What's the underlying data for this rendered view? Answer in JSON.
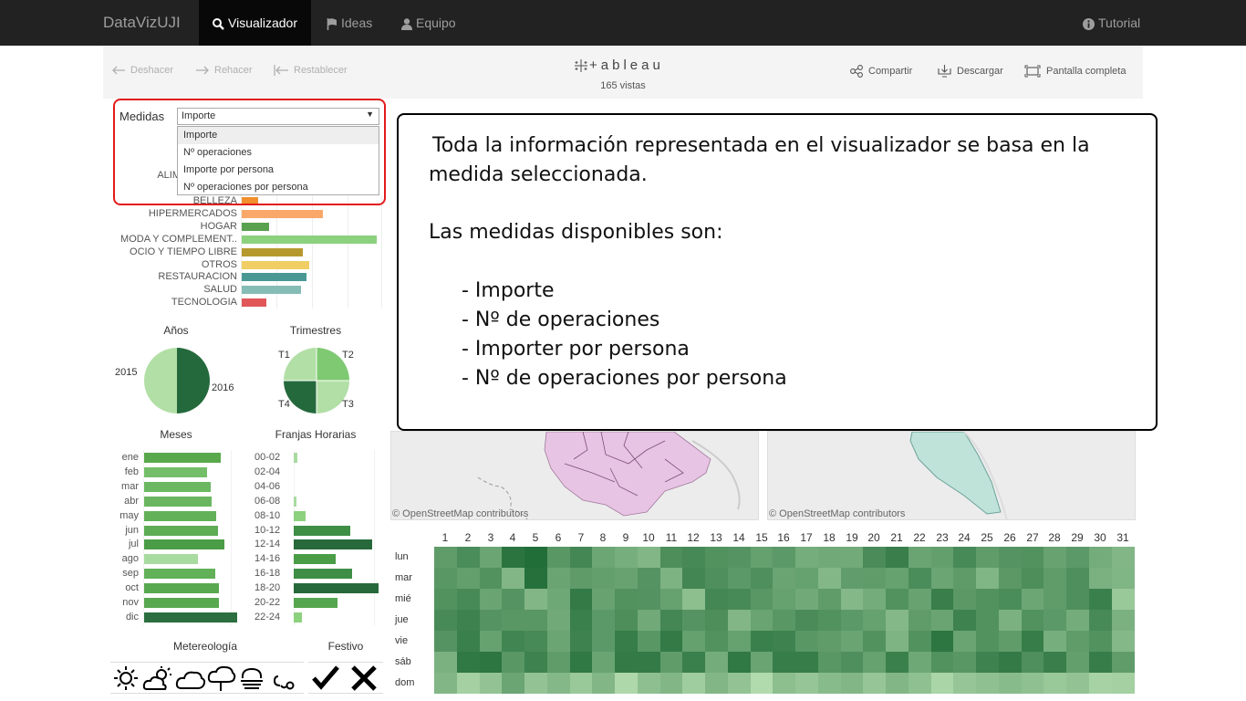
{
  "navbar": {
    "brand": "DataVizUJI",
    "items": [
      {
        "label": "Visualizador",
        "icon": "search-icon",
        "active": true
      },
      {
        "label": "Ideas",
        "icon": "flag-icon",
        "active": false
      },
      {
        "label": "Equipo",
        "icon": "user-icon",
        "active": false
      }
    ],
    "tutorial": {
      "label": "Tutorial",
      "icon": "info-icon"
    }
  },
  "toolbar": {
    "undo": "Deshacer",
    "redo": "Rehacer",
    "reset": "Restablecer",
    "logo": "+ableau",
    "views": "165 vistas",
    "share": "Compartir",
    "download": "Descargar",
    "fullscreen": "Pantalla completa"
  },
  "medidas": {
    "label": "Medidas",
    "selected": "Importe",
    "options": [
      "Importe",
      "Nº operaciones",
      "Importe por persona",
      "Nº operaciones por persona"
    ]
  },
  "categories": {
    "partial_label": "ALIM",
    "items": [
      {
        "label": "BELLEZA",
        "value": 0.12,
        "color": "#f28e2b"
      },
      {
        "label": "HIPERMERCADOS",
        "value": 0.6,
        "color": "#f9a86a"
      },
      {
        "label": "HOGAR",
        "value": 0.2,
        "color": "#59a14f"
      },
      {
        "label": "MODA Y COMPLEMENT..",
        "value": 1.0,
        "color": "#8cd17d"
      },
      {
        "label": "OCIO Y TIEMPO LIBRE",
        "value": 0.45,
        "color": "#b6992d"
      },
      {
        "label": "OTROS",
        "value": 0.5,
        "color": "#f1ce63"
      },
      {
        "label": "RESTAURACION",
        "value": 0.48,
        "color": "#499894"
      },
      {
        "label": "SALUD",
        "value": 0.44,
        "color": "#86bcb6"
      },
      {
        "label": "TECNOLOGIA",
        "value": 0.18,
        "color": "#e15759"
      }
    ]
  },
  "years": {
    "title": "Años",
    "labels": [
      "2015",
      "2016"
    ]
  },
  "quarters": {
    "title": "Trimestres",
    "labels": [
      "T1",
      "T2",
      "T3",
      "T4"
    ]
  },
  "months": {
    "title": "Meses",
    "items": [
      {
        "label": "ene",
        "value": 0.82,
        "color": "#59a84b"
      },
      {
        "label": "feb",
        "value": 0.68,
        "color": "#74be6a"
      },
      {
        "label": "mar",
        "value": 0.72,
        "color": "#6cb762"
      },
      {
        "label": "abr",
        "value": 0.73,
        "color": "#6ab660"
      },
      {
        "label": "may",
        "value": 0.77,
        "color": "#62b159"
      },
      {
        "label": "jun",
        "value": 0.79,
        "color": "#5ead54"
      },
      {
        "label": "jul",
        "value": 0.86,
        "color": "#4a9d46"
      },
      {
        "label": "ago",
        "value": 0.58,
        "color": "#a8dba0"
      },
      {
        "label": "sep",
        "value": 0.76,
        "color": "#62b159"
      },
      {
        "label": "oct",
        "value": 0.8,
        "color": "#58a850"
      },
      {
        "label": "nov",
        "value": 0.8,
        "color": "#58a850"
      },
      {
        "label": "dic",
        "value": 1.0,
        "color": "#2c6e3f"
      }
    ]
  },
  "hours": {
    "title": "Franjas Horarias",
    "items": [
      {
        "label": "00-02",
        "value": 0.04,
        "color": "#a8dba0"
      },
      {
        "label": "02-04",
        "value": 0.0,
        "color": "#a8dba0"
      },
      {
        "label": "04-06",
        "value": 0.0,
        "color": "#a8dba0"
      },
      {
        "label": "06-08",
        "value": 0.03,
        "color": "#a8dba0"
      },
      {
        "label": "08-10",
        "value": 0.14,
        "color": "#8cd17d"
      },
      {
        "label": "10-12",
        "value": 0.67,
        "color": "#3e8e45"
      },
      {
        "label": "12-14",
        "value": 0.93,
        "color": "#27693a"
      },
      {
        "label": "14-16",
        "value": 0.49,
        "color": "#4a9d46"
      },
      {
        "label": "16-18",
        "value": 0.69,
        "color": "#3e8e45"
      },
      {
        "label": "18-20",
        "value": 1.0,
        "color": "#27693a"
      },
      {
        "label": "20-22",
        "value": 0.52,
        "color": "#55a64e"
      },
      {
        "label": "22-24",
        "value": 0.1,
        "color": "#8cd17d"
      }
    ]
  },
  "weather": {
    "title": "Metereología",
    "icons": [
      "sun-icon",
      "sun-cloud-icon",
      "cloud-icon",
      "rain-cloud-icon",
      "fog-icon",
      "wind-icon"
    ]
  },
  "holiday": {
    "title": "Festivo",
    "icons": [
      "check-icon",
      "cross-icon"
    ]
  },
  "maps": {
    "attribution": "© OpenStreetMap contributors"
  },
  "heatmap": {
    "days": [
      "1",
      "2",
      "3",
      "4",
      "5",
      "6",
      "7",
      "8",
      "9",
      "10",
      "11",
      "12",
      "13",
      "14",
      "15",
      "16",
      "17",
      "18",
      "19",
      "20",
      "21",
      "22",
      "23",
      "24",
      "25",
      "26",
      "27",
      "28",
      "29",
      "30",
      "31"
    ],
    "weekdays": [
      "lun",
      "mar",
      "mié",
      "jue",
      "vie",
      "sáb",
      "dom"
    ],
    "values": [
      [
        0.62,
        0.74,
        0.55,
        0.93,
        0.98,
        0.66,
        0.78,
        0.54,
        0.48,
        0.42,
        0.73,
        0.77,
        0.7,
        0.68,
        0.59,
        0.64,
        0.49,
        0.52,
        0.51,
        0.75,
        0.85,
        0.56,
        0.6,
        0.76,
        0.62,
        0.68,
        0.7,
        0.57,
        0.64,
        0.5,
        0.42
      ],
      [
        0.66,
        0.6,
        0.7,
        0.42,
        0.96,
        0.56,
        0.63,
        0.6,
        0.57,
        0.68,
        0.45,
        0.79,
        0.72,
        0.64,
        0.72,
        0.56,
        0.58,
        0.41,
        0.61,
        0.62,
        0.58,
        0.74,
        0.55,
        0.63,
        0.43,
        0.65,
        0.73,
        0.62,
        0.72,
        0.46,
        0.43
      ],
      [
        0.7,
        0.76,
        0.56,
        0.68,
        0.42,
        0.53,
        0.88,
        0.57,
        0.7,
        0.69,
        0.58,
        0.36,
        0.78,
        0.76,
        0.66,
        0.58,
        0.52,
        0.62,
        0.4,
        0.5,
        0.7,
        0.57,
        0.85,
        0.65,
        0.7,
        0.74,
        0.54,
        0.62,
        0.72,
        0.84,
        0.28
      ],
      [
        0.76,
        0.82,
        0.68,
        0.66,
        0.66,
        0.52,
        0.84,
        0.64,
        0.73,
        0.52,
        0.78,
        0.68,
        0.73,
        0.42,
        0.56,
        0.66,
        0.75,
        0.7,
        0.64,
        0.58,
        0.4,
        0.62,
        0.56,
        0.82,
        0.7,
        0.46,
        0.7,
        0.64,
        0.5,
        0.76,
        0.46
      ],
      [
        0.68,
        0.84,
        0.58,
        0.8,
        0.76,
        0.55,
        0.82,
        0.64,
        0.86,
        0.66,
        0.88,
        0.59,
        0.7,
        0.58,
        0.84,
        0.82,
        0.66,
        0.62,
        0.56,
        0.7,
        0.44,
        0.7,
        0.92,
        0.56,
        0.7,
        0.62,
        0.86,
        0.48,
        0.62,
        0.7,
        0.4
      ],
      [
        0.46,
        0.9,
        0.92,
        0.66,
        0.82,
        0.62,
        0.9,
        0.56,
        0.88,
        0.88,
        0.62,
        0.84,
        0.5,
        0.9,
        0.56,
        0.86,
        0.86,
        0.66,
        0.72,
        0.58,
        0.84,
        0.53,
        0.7,
        0.66,
        0.82,
        0.88,
        0.72,
        0.85,
        0.6,
        0.86,
        0.62
      ],
      [
        0.42,
        0.22,
        0.32,
        0.55,
        0.32,
        0.4,
        0.28,
        0.42,
        0.16,
        0.35,
        0.42,
        0.24,
        0.42,
        0.32,
        0.14,
        0.36,
        0.3,
        0.38,
        0.42,
        0.3,
        0.42,
        0.34,
        0.18,
        0.3,
        0.34,
        0.38,
        0.34,
        0.28,
        0.32,
        0.2,
        0.22
      ]
    ]
  },
  "callout": {
    "line1": "Toda la información representada en el visualizador se basa en la",
    "line2": "medida seleccionada.",
    "line3": "Las medidas disponibles son:",
    "items": [
      "- Importe",
      "- Nº de operaciones",
      "- Importer por persona",
      "- Nº de operaciones por persona"
    ]
  }
}
